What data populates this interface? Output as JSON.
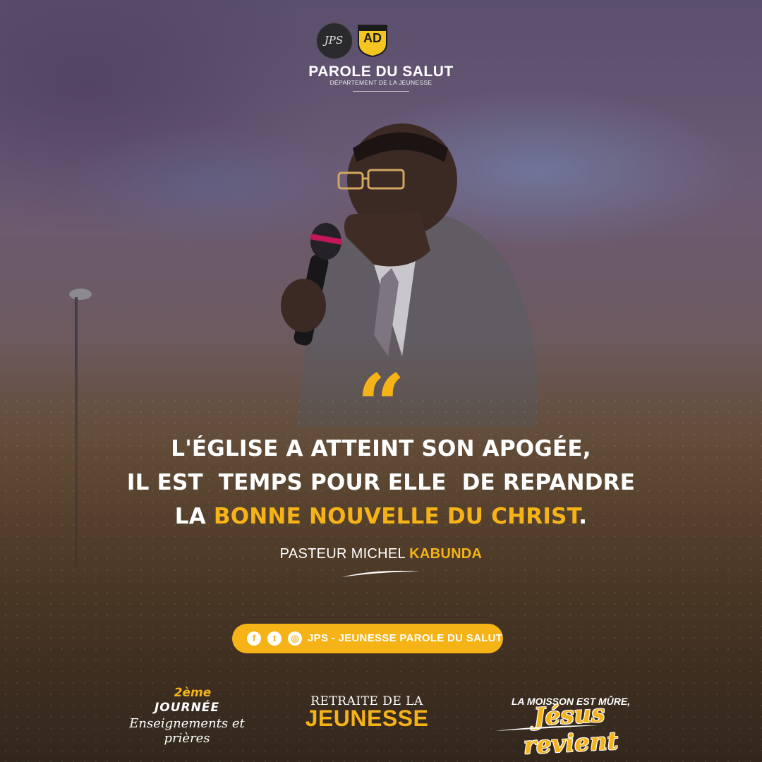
{
  "header": {
    "logo_left_text": "JPS",
    "logo_right_text": "AD",
    "brand_title": "PAROLE DU SALUT",
    "brand_subtitle": "DÉPARTEMENT DE LA JEUNESSE"
  },
  "quote": {
    "mark": "“",
    "line1": "L'ÉGLISE A ATTEINT SON APOGÉE,",
    "line2": "IL EST  TEMPS POUR ELLE  DE REPANDRE",
    "line3_prefix": "LA ",
    "line3_highlight": "BONNE NOUVELLE DU CHRIST",
    "line3_suffix": "."
  },
  "author": {
    "prefix": "PASTEUR MICHEL ",
    "highlight": "KABUNDA"
  },
  "social": {
    "icons": [
      "facebook-icon",
      "twitter-icon",
      "instagram-icon"
    ],
    "glyph_facebook": "f",
    "glyph_twitter": "t",
    "glyph_instagram": "◎",
    "label": "JPS - JEUNESSE PAROLE DU SALUT"
  },
  "footer": {
    "day_number": "2ème",
    "day_word": "JOURNÉE",
    "day_subtitle": "Enseignements et prières",
    "retreat_top": "RETRAITE DE LA",
    "retreat_main": "JEUNESSE",
    "slogan_top": "LA MOISSON EST MÛRE,",
    "slogan_main": "Jésus revient"
  },
  "colors": {
    "accent": "#f5b317",
    "text": "#ffffff"
  }
}
